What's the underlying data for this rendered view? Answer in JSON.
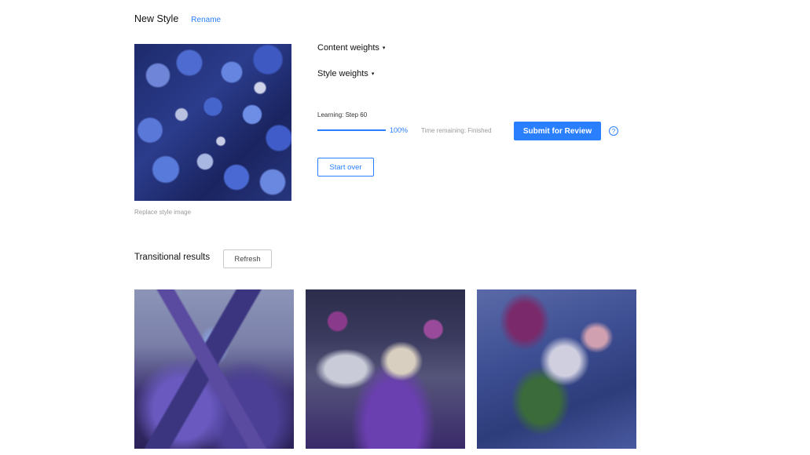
{
  "header": {
    "title": "New Style",
    "rename_label": "Rename"
  },
  "style_panel": {
    "replace_label": "Replace style image"
  },
  "controls": {
    "content_weights_label": "Content weights",
    "style_weights_label": "Style weights",
    "learning_label": "Learning: Step 60",
    "progress": 1.0,
    "progress_label": "100%",
    "time_remaining_label": "Time remaining: Finished",
    "submit_label": "Submit for Review",
    "help_glyph": "?",
    "start_over_label": "Start over",
    "caret_glyph": "▾"
  },
  "transitional": {
    "title": "Transitional results",
    "refresh_label": "Refresh"
  },
  "colors": {
    "accent": "#2a7fff"
  }
}
